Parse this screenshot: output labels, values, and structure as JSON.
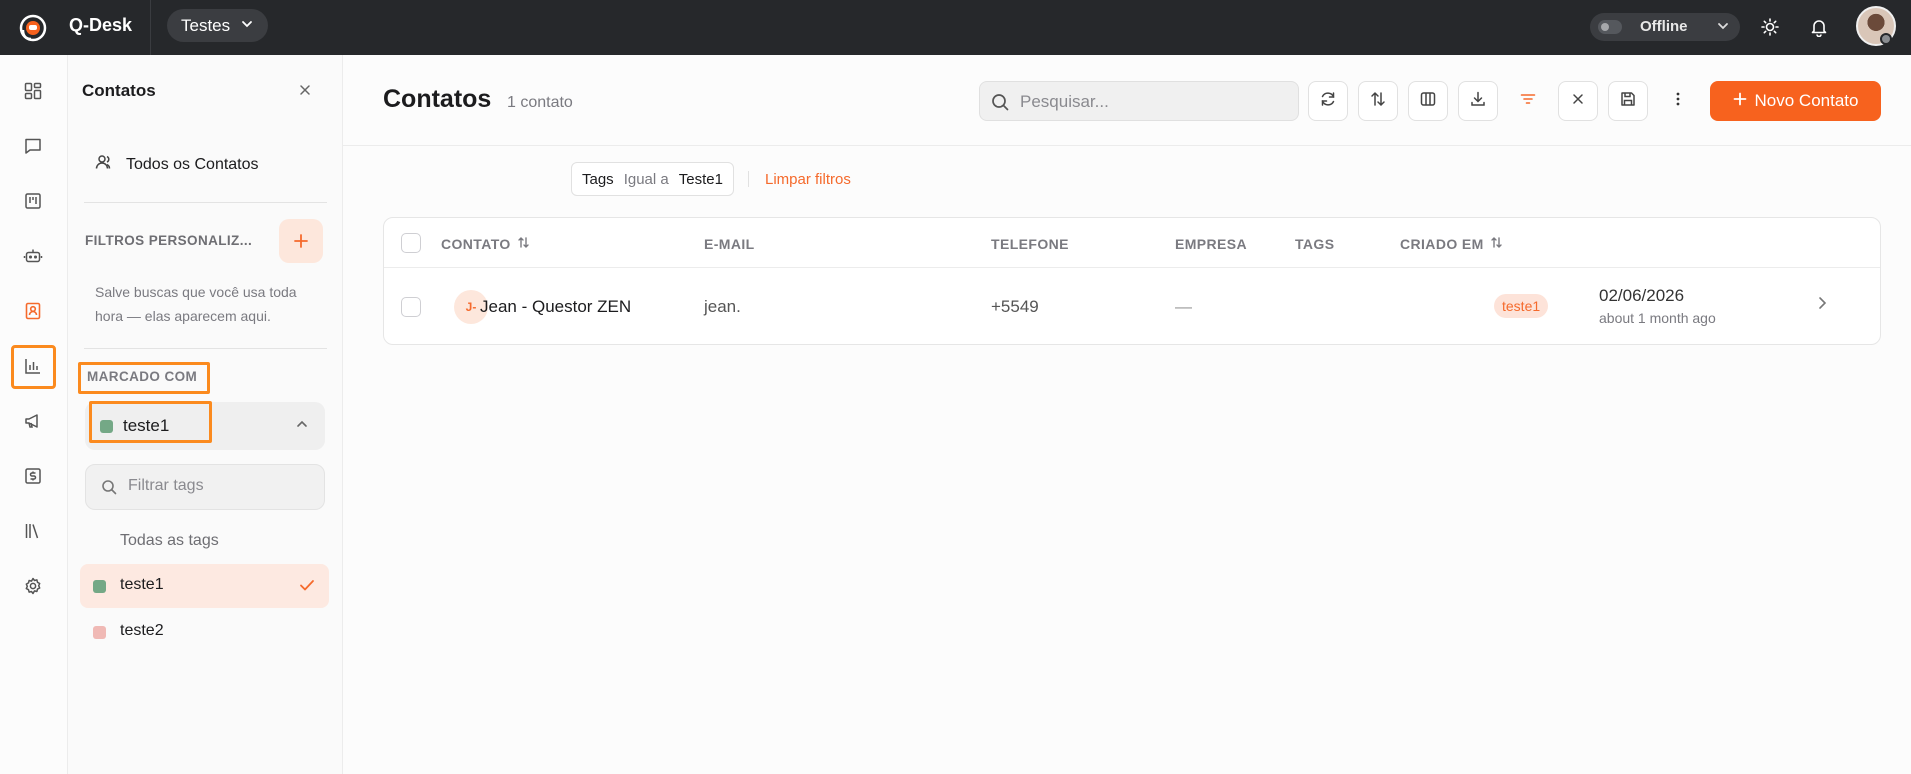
{
  "app": {
    "name": "Q-Desk",
    "workspace": "Testes",
    "status": "Offline"
  },
  "rail": {
    "items": [
      "dashboard-icon",
      "chat-icon",
      "kanban-icon",
      "bot-icon",
      "contacts-icon",
      "reports-icon",
      "campaigns-icon",
      "billing-icon",
      "library-icon",
      "settings-icon"
    ],
    "active": "contacts-icon"
  },
  "panel": {
    "title": "Contatos",
    "all_contacts": "Todos os Contatos",
    "filters_label": "FILTROS PERSONALIZ...",
    "filters_hint": "Salve buscas que você usa toda hora — elas aparecem aqui.",
    "tagged_label": "MARCADO COM",
    "selected_tag": "teste1",
    "tag_search_placeholder": "Filtrar tags",
    "all_tags": "Todas as tags",
    "tags": [
      {
        "label": "teste1",
        "color": "#74a886",
        "active": true
      },
      {
        "label": "teste2",
        "color": "#f0b9b5",
        "active": false
      }
    ]
  },
  "main": {
    "title": "Contatos",
    "count": "1 contato",
    "search_placeholder": "Pesquisar...",
    "new_button": "Novo Contato",
    "filter_chip": {
      "field": "Tags",
      "operator": "Igual a",
      "value": "Teste1"
    },
    "clear_filters": "Limpar filtros",
    "columns": [
      "CONTATO",
      "E-MAIL",
      "TELEFONE",
      "EMPRESA",
      "TAGS",
      "CRIADO EM"
    ],
    "rows": [
      {
        "initials": "J-",
        "name": "Jean - Questor ZEN",
        "email": "jean.",
        "phone": "+5549",
        "company": "—",
        "tag": "teste1",
        "created": "02/06/2026",
        "created_ago": "about 1 month ago"
      }
    ]
  },
  "colors": {
    "accent": "#f7621e",
    "topbar": "#26282b",
    "highlight": "#fb8a1e"
  }
}
